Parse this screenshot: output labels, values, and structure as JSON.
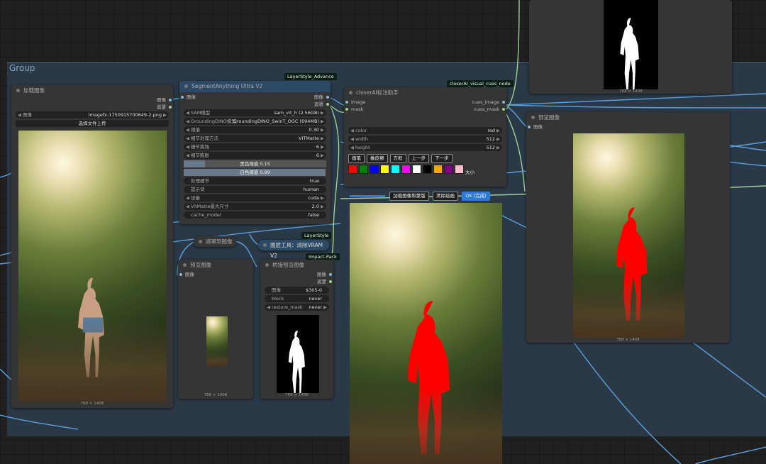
{
  "group": {
    "title": "Group"
  },
  "badges": {
    "layerstyle_advance": "LayerStyle_Advance",
    "closerai": "closerAI_visual_cues_node",
    "layerstyle": "LayerStyle",
    "impact_pack": "Impact-Pack"
  },
  "load_image": {
    "title": "加载图像",
    "outputs": [
      "图像",
      "遮罩"
    ],
    "image_label": "图像",
    "image_value": "imagefx-1750915700649-2.png",
    "upload_label": "选择文件上传",
    "caption": "768 × 1408"
  },
  "segment": {
    "title": "SegmentAnything Ultra V2",
    "input": "图像",
    "outputs": [
      "图像",
      "遮罩"
    ],
    "widgets": [
      {
        "label": "SAM模型",
        "value": "sam_vit_h (2.56GB)"
      },
      {
        "label": "GroundingDINO模型",
        "value": "GroundingDINO_SwinT_OGC (694MB)"
      },
      {
        "label": "阈值",
        "value": "0.30"
      },
      {
        "label": "细节处理方法",
        "value": "VITMatte"
      },
      {
        "label": "细节腐蚀",
        "value": "6"
      },
      {
        "label": "细节膨胀",
        "value": "6"
      }
    ],
    "black_threshold": "黑色阈值 0.15",
    "white_threshold": "白色阈值 0.99",
    "widgets2": [
      {
        "label": "处理细节",
        "value": "true"
      },
      {
        "label": "提示词",
        "value": "human"
      },
      {
        "label": "设备",
        "value": "cuda"
      },
      {
        "label": "VitMatte最大尺寸",
        "value": "2.0"
      },
      {
        "label": "cache_model",
        "value": "false"
      }
    ]
  },
  "mask_to_image": {
    "title": "遮罩到图像"
  },
  "clear_vram": {
    "title": "图层工具：清除VRAM V2"
  },
  "preview_small": {
    "title": "预览图像",
    "input": "图像",
    "caption": "768 × 1408"
  },
  "bridge": {
    "title": "桥接预览图像",
    "outputs": [
      "图像",
      "遮罩"
    ],
    "widgets": [
      {
        "label": "图像",
        "value": "$305-0"
      },
      {
        "label": "block",
        "value": "never"
      },
      {
        "label": "restore_mask",
        "value": "never"
      }
    ],
    "caption": "768 × 1408"
  },
  "closer": {
    "title": "closerAI标注助手",
    "inputs": [
      "image",
      "mask"
    ],
    "outputs": [
      "cues_image",
      "cues_mask"
    ],
    "widgets": [
      {
        "label": "color",
        "value": "red"
      },
      {
        "label": "width",
        "value": "512"
      },
      {
        "label": "height",
        "value": "512"
      }
    ],
    "tools": [
      "画笔",
      "橡皮擦",
      "方框",
      "上一步",
      "下一步"
    ],
    "swatch_colors": [
      "#ff0000",
      "#008000",
      "#0000ff",
      "#ffff00",
      "#00ffff",
      "#ff00ff",
      "#ffffff",
      "#000000",
      "#ffa500",
      "#800080",
      "#ffc0cb"
    ],
    "size_label": "大小",
    "actions": [
      "加载图像和蒙版",
      "清除绘画",
      "OK (完成)"
    ]
  },
  "preview_big": {
    "title": "预览图像",
    "input": "图像",
    "caption": "768 × 1408"
  },
  "top_preview": {
    "caption": "768 × 1408"
  }
}
